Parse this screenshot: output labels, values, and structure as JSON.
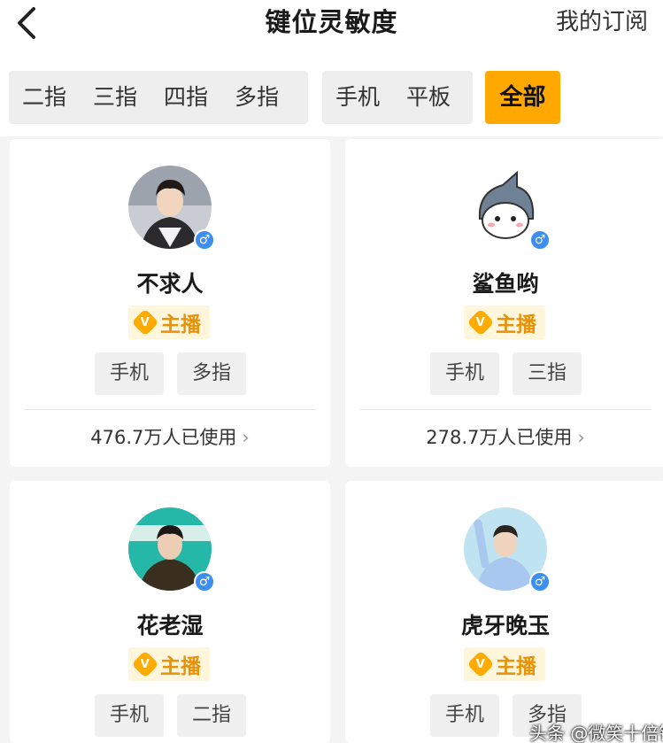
{
  "header": {
    "title": "键位灵敏度",
    "subscribe_tab": "我的订阅"
  },
  "filters": {
    "fingers": [
      "二指",
      "三指",
      "四指",
      "多指"
    ],
    "devices": [
      "手机",
      "平板"
    ],
    "all": "全部"
  },
  "cards": [
    {
      "name": "不求人",
      "badge": "主播",
      "badge_icon": "V",
      "gender": "♂",
      "tags": [
        "手机",
        "多指"
      ],
      "usage": "476.7万人已使用"
    },
    {
      "name": "鲨鱼哟",
      "badge": "主播",
      "badge_icon": "V",
      "gender": "♂",
      "tags": [
        "手机",
        "三指"
      ],
      "usage": "278.7万人已使用"
    },
    {
      "name": "花老湿",
      "badge": "主播",
      "badge_icon": "V",
      "gender": "♂",
      "tags": [
        "手机",
        "二指"
      ]
    },
    {
      "name": "虎牙晚玉",
      "badge": "主播",
      "badge_icon": "V",
      "gender": "♂",
      "tags": [
        "手机",
        "多指"
      ]
    }
  ],
  "watermark": "头条 @微笑十倍镜",
  "colors": {
    "accent": "#ffa800",
    "badge_text": "#e8920a",
    "gender_blue": "#3c8ff0"
  }
}
